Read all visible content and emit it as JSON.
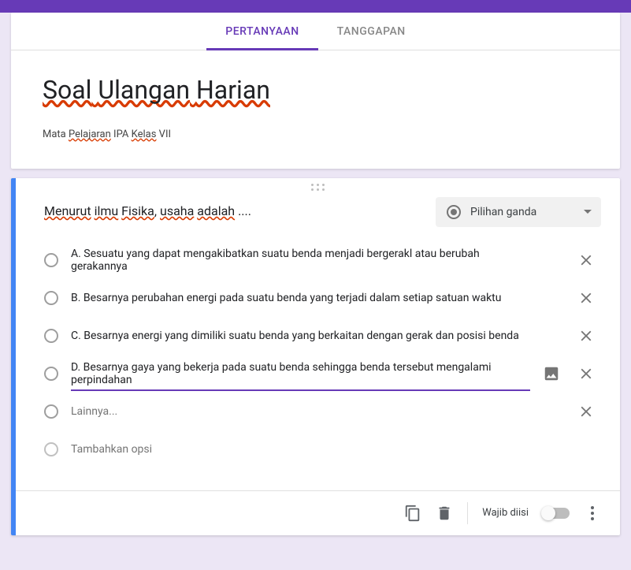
{
  "tabs": {
    "questions": "PERTANYAAN",
    "responses": "TANGGAPAN"
  },
  "header": {
    "title_parts": [
      "Soal",
      " ",
      "Ulangan",
      " ",
      "Harian"
    ],
    "desc_prefix": "Mata ",
    "desc_w1": "Pelajaran",
    "desc_mid": " IPA ",
    "desc_w2": "Kelas",
    "desc_suffix": " VII"
  },
  "question": {
    "text_parts": {
      "w1": "Menurut",
      "sp1": " ",
      "w2": "ilmu",
      "sp2": " ",
      "w3": "Fisika",
      "sp3": ", ",
      "w4": "usaha",
      "sp4": " ",
      "w5": "adalah",
      "tail": " ...."
    },
    "type_label": "Pilihan ganda",
    "options": [
      "A. Sesuatu yang dapat mengakibatkan suatu benda menjadi bergerakl atau berubah gerakannya",
      "B. Besarnya perubahan energi pada suatu benda yang terjadi dalam setiap satuan waktu",
      "C. Besarnya energi yang dimiliki suatu benda yang berkaitan dengan gerak dan posisi benda",
      "D. Besarnya gaya yang bekerja pada suatu benda sehingga benda tersebut mengalami perpindahan"
    ],
    "other_label": "Lainnya...",
    "add_option_label": "Tambahkan opsi"
  },
  "footer": {
    "required_label": "Wajib diisi"
  }
}
